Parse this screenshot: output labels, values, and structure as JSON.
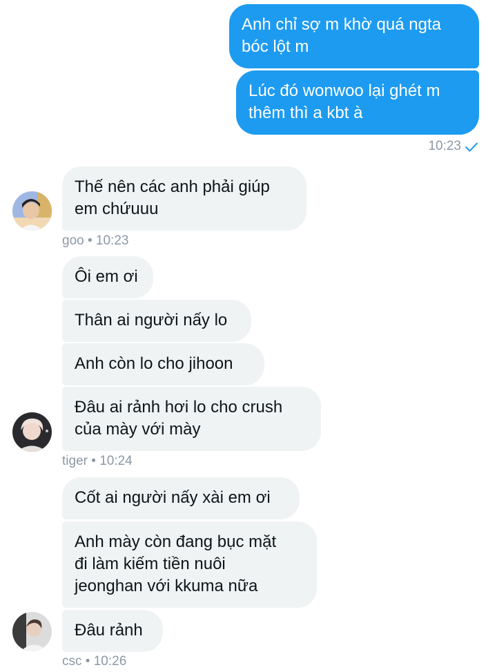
{
  "conversation": {
    "sent": [
      "Anh chỉ sợ m khờ quá ngta\nbóc lột m",
      "Lúc đó wonwoo lại ghét m\nthêm thì a kbt à"
    ],
    "sent_time": "10:23",
    "groups": [
      {
        "sender": "goo",
        "time": "10:23",
        "messages": [
          "Thế nên các anh phải giúp\nem chứuuu"
        ]
      },
      {
        "sender": "tiger",
        "time": "10:24",
        "messages": [
          "Ôi em ơi",
          "Thân ai người nấy lo",
          "Anh còn lo cho jihoon",
          "Đâu ai rảnh hơi lo cho crush\ncủa mày với mày"
        ]
      },
      {
        "sender": "csc",
        "time": "10:26",
        "messages": [
          "Cốt ai người nấy xài em ơi",
          "Anh mày còn đang bục mặt\nđi làm kiếm tiền nuôi\njeonghan với kkuma nữa",
          "Đâu rảnh"
        ]
      }
    ],
    "separator": "•"
  },
  "colors": {
    "outgoing_bubble": "#1d9bf0",
    "incoming_bubble": "#eff3f4",
    "meta_text": "#8b98a5",
    "read_check": "#1d9bf0"
  },
  "icons": {
    "read_receipt": "checkmark-icon",
    "avatars": [
      "avatar-goo",
      "avatar-tiger",
      "avatar-csc"
    ]
  }
}
